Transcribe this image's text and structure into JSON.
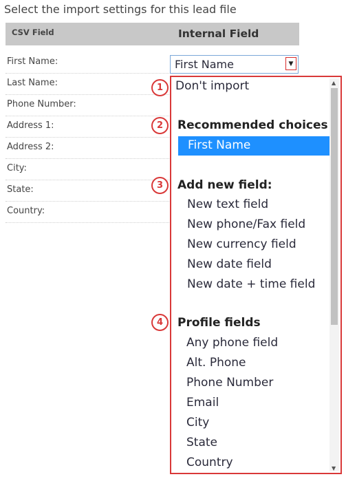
{
  "heading": "Select the import settings for this lead file",
  "table_header": {
    "csv_field": "CSV Field",
    "internal_field": "Internal Field"
  },
  "csv_rows": [
    "First Name:",
    "Last Name:",
    "Phone Number:",
    "Address 1:",
    "Address 2:",
    "City:",
    "State:",
    "Country:"
  ],
  "select": {
    "value": "First Name",
    "arrow": "▼"
  },
  "dropdown": {
    "dont_import": "Don't import",
    "recommended_label": "Recommended choices",
    "recommended_items": [
      "First Name"
    ],
    "add_new_label": "Add new field:",
    "add_new_items": [
      "New text field",
      "New phone/Fax field",
      "New currency field",
      "New date field",
      "New date + time field"
    ],
    "profile_label": "Profile fields",
    "profile_items": [
      "Any phone field",
      "Alt. Phone",
      "Phone Number",
      "Email",
      "City",
      "State",
      "Country"
    ]
  },
  "badges": [
    "1",
    "2",
    "3",
    "4"
  ],
  "colors": {
    "highlight": "#1e90ff",
    "annotation_red": "#d93838",
    "header_bg": "#c8c8c8"
  }
}
